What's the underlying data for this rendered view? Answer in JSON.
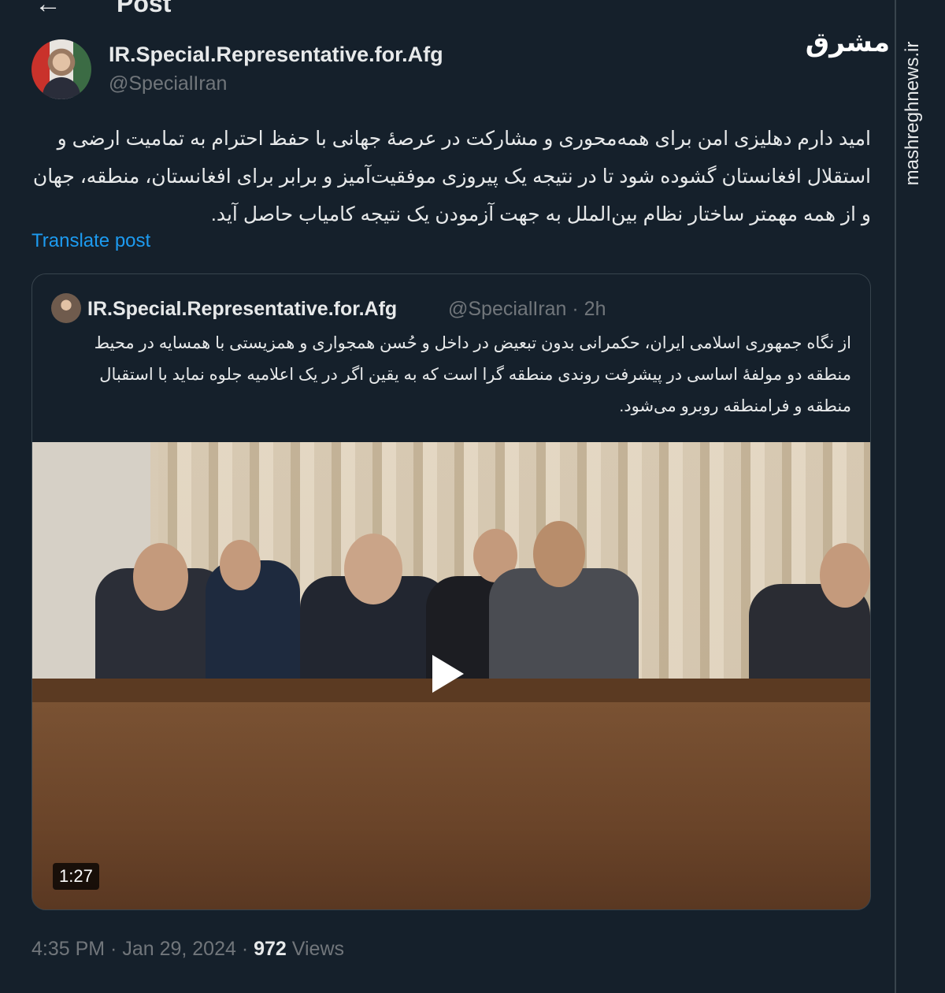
{
  "header": {
    "back_icon": "←",
    "title": "Post"
  },
  "author": {
    "name": "IR.Special.Representative.for.Afg",
    "handle": "@SpecialIran"
  },
  "tweet": {
    "text": "امید دارم دهلیزی امن برای همه‌محوری و مشارکت در عرصهٔ جهانی با حفظ احترام به تمامیت ارضی و استقلال افغانستان گشوده شود تا در نتیجه یک پیروزی موفقیت‌آمیز و برابر برای افغانستان، منطقه، جهان و از همه مهمتر ساختار نظام بین‌الملل به جهت آزمودن یک نتیجه کامیاب حاصل آید.",
    "translate_label": "Translate post"
  },
  "quote": {
    "name": "IR.Special.Representative.for.Afg",
    "handle_time": "@SpecialIran · 2h",
    "text": "از نگاه جمهوری اسلامی ایران، حکمرانی بدون تبعیض در داخل و حُسن همجواری و همزیستی با همسایه در محیط منطقه دو مولفهٔ اساسی در پیشرفت روندی منطقه گرا است که به یقین اگر در یک اعلامیه جلوه نماید با استقبال منطقه و فرامنطقه روبرو می‌شود.",
    "video_duration": "1:27"
  },
  "meta": {
    "time_date": "4:35 PM · Jan 29, 2024 · ",
    "views_count": "972",
    "views_label": " Views"
  },
  "watermark": {
    "logo": "مشرق",
    "url": "mashreghnews.ir"
  },
  "icons": {
    "play": "play-icon",
    "back": "back-arrow-icon"
  },
  "colors": {
    "background": "#15202b",
    "link": "#1d9bf0",
    "muted": "#71767b"
  }
}
